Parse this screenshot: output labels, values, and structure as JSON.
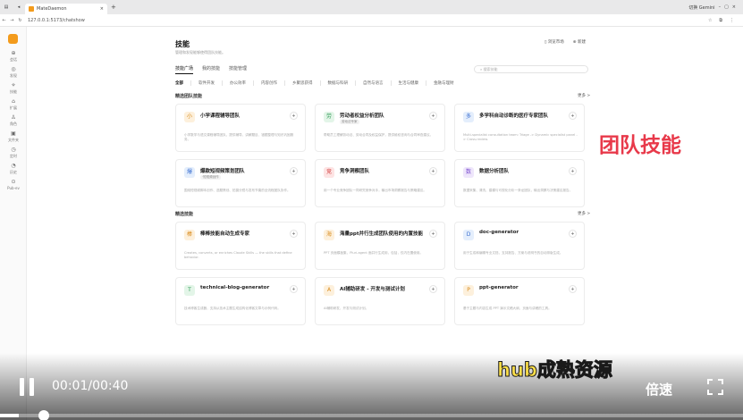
{
  "browser": {
    "tab_title": "MateDaemon",
    "url": "127.0.0.1:5173/chatshow",
    "profile": "切换 Gemini"
  },
  "rail": [
    {
      "glyph": "⊕",
      "label": "会话"
    },
    {
      "glyph": "◎",
      "label": "发现"
    },
    {
      "glyph": "✧",
      "label": "技能"
    },
    {
      "glyph": "⌂",
      "label": "扩展"
    },
    {
      "glyph": "♙",
      "label": "角色"
    },
    {
      "glyph": "▣",
      "label": "文件夹"
    },
    {
      "glyph": "◷",
      "label": "定时"
    },
    {
      "glyph": "◔",
      "label": "历史"
    },
    {
      "glyph": "⊙",
      "label": "Pub-ev"
    }
  ],
  "header": {
    "title": "技能",
    "subtitle": "管理和发现能够使得团队技能。",
    "action_browse": "浏览市场",
    "action_new": "新建"
  },
  "tabs": [
    "技能广场",
    "我的技能",
    "技能管理"
  ],
  "search_placeholder": "搜索技能",
  "categories": [
    "全部",
    "软件开发",
    "办公效率",
    "内容创作",
    "乡聚思获得",
    "数据与科研",
    "自然与语言",
    "生活与健康",
    "金融与理财"
  ],
  "team_section": {
    "title": "精选团队技能",
    "more": "更多 >"
  },
  "team_cards": [
    {
      "icon": "小",
      "icon_bg": "#fdf0dc",
      "icon_fg": "#d88a1a",
      "name": "小学课程辅导团队",
      "tag": "",
      "desc": "小学数学与语文课程辅导团队，提供辅导、讲解题目、错题整理与知识巩固服务。"
    },
    {
      "icon": "劳",
      "icon_bg": "#e3f5e8",
      "icon_fg": "#2f9a55",
      "name": "劳动者权益分析团队",
      "tag": "劳动法专家",
      "desc": "帮助员工理解劳动法、劳动合同及权益保护，提供维权咨询与合同审查建议。"
    },
    {
      "icon": "多",
      "icon_bg": "#e4eefc",
      "icon_fg": "#3b6fd0",
      "name": "多学科自动诊断的医疗专家团队",
      "tag": "",
      "desc": "Multi-specialist consultation team: Triage -> Dynamic specialist panel -> Cross-review."
    },
    {
      "icon": "爆",
      "icon_bg": "#e4eefc",
      "icon_fg": "#3b6fd0",
      "name": "爆款短视频策划团队",
      "tag": "·短视频创作",
      "desc": "围绕短视频脚本创作、选题策划、拍摄分镜与发布节奏的全流程团队协作。"
    },
    {
      "icon": "竞",
      "icon_bg": "#fde4e4",
      "icon_fg": "#d23b3b",
      "name": "竞争洞察团队",
      "tag": "",
      "desc": "用一个专业竞争团队一同研究竞争对手，输出市场洞察报告与策略建议。"
    },
    {
      "icon": "数",
      "icon_bg": "#eee6fb",
      "icon_fg": "#7a4ccf",
      "name": "数据分析团队",
      "tag": "",
      "desc": "数据采集、清洗、建模与可视化分析一条龙团队，输出洞察与决策建议报告。"
    }
  ],
  "skill_section": {
    "title": "精选技能",
    "more": "更多 >"
  },
  "skill_cards": [
    {
      "icon": "棒",
      "icon_bg": "#fdf0dc",
      "icon_fg": "#d88a1a",
      "name": "棒棒技能自动生成专家",
      "desc": "Creates, converts, or enriches Claude Skills — the skills that define behavior."
    },
    {
      "icon": "海",
      "icon_bg": "#fdf0dc",
      "icon_fg": "#d88a1a",
      "name": "海量ppt并行生成团队使用的内置技能",
      "desc": "PPT 页面模板集，Pluri-agent 面并行生成用，包括，仅内在置使用。"
    },
    {
      "icon": "D",
      "icon_bg": "#e4eefc",
      "icon_fg": "#3b6fd0",
      "name": "doc-generator",
      "desc": "用于生成和编辑专业文档，支持报告、方案与说明书的自动排版生成。"
    },
    {
      "icon": "T",
      "icon_bg": "#e3f5e8",
      "icon_fg": "#2f9a55",
      "name": "technical-blog-generator",
      "desc": "技术博客生成器，支持从技术主题生成结构化博客文章与示例代码。"
    },
    {
      "icon": "A",
      "icon_bg": "#fdf0dc",
      "icon_fg": "#d88a1a",
      "name": "AI辅助研发 - 开发与测试计划",
      "desc": "AI辅助研发，开发与测试计划。"
    },
    {
      "icon": "P",
      "icon_bg": "#fdf0dc",
      "icon_fg": "#d88a1a",
      "name": "ppt-generator",
      "desc": "基于主题与内容生成 PPT 演示文稿大纲、页面与讲稿的工具。"
    }
  ],
  "overlay": {
    "caption_top": "团队技能",
    "caption_bottom": "hub成熟资源",
    "time": "00:01/00:40",
    "speed": "倍速",
    "progress": 0.025
  },
  "colors": {
    "accent": "#f39b1c",
    "caption_top": "#e8394a",
    "caption_bottom": "#ffe14a"
  }
}
